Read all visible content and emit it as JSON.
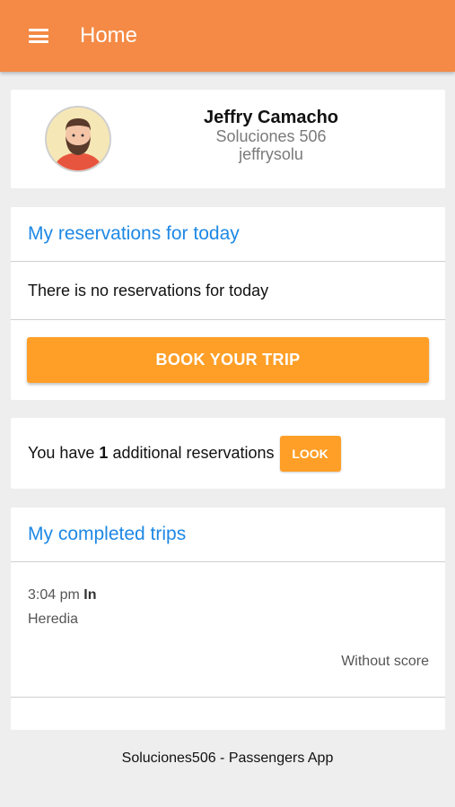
{
  "appbar": {
    "title": "Home"
  },
  "profile": {
    "name": "Jeffry Camacho",
    "company": "Soluciones 506",
    "username": "jeffrysolu"
  },
  "reservations": {
    "header": "My reservations for today",
    "empty_message": "There is no reservations for today",
    "book_button": "BOOK YOUR TRIP"
  },
  "additional": {
    "text_before": "You have ",
    "count": "1",
    "text_after": " additional reservations",
    "look_button": "LOOK"
  },
  "completed": {
    "header": "My completed trips",
    "trips": [
      {
        "time": "3:04 pm",
        "direction": "In",
        "place": "Heredia",
        "score": "Without score"
      }
    ]
  },
  "footer": {
    "text": "Soluciones506 - Passengers App"
  },
  "colors": {
    "appbar": "#f48a45",
    "accent_button": "#ff9f27",
    "header_blue": "#1e88e5"
  }
}
